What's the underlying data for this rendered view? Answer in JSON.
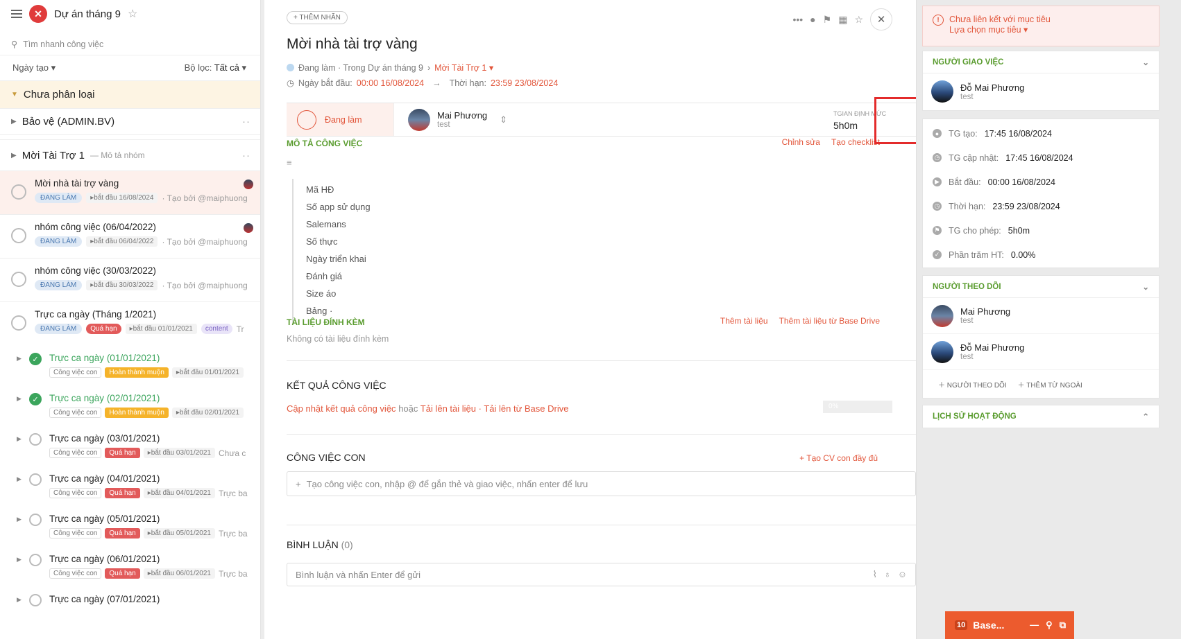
{
  "project": {
    "title": "Dự án tháng 9"
  },
  "search": {
    "placeholder": "Tìm nhanh công việc"
  },
  "filter": {
    "sort": "Ngày tạo",
    "label": "Bộ lọc:",
    "value": "Tất cả"
  },
  "groups": {
    "uncategorized": "Chưa phân loại",
    "protect": "Bảo vệ (ADMIN.BV)",
    "sponsor": "Mời Tài Trợ 1",
    "sponsor_desc": "Mô tả nhóm"
  },
  "tasks": [
    {
      "title": "Mời nhà tài trợ vàng",
      "status": "ĐANG LÀM",
      "date": "bắt đầu 16/08/2024",
      "by": "· Tạo bởi @maiphuong"
    },
    {
      "title": "nhóm công việc (06/04/2022)",
      "status": "ĐANG LÀM",
      "date": "bắt đầu 06/04/2022",
      "by": "· Tạo bởi @maiphuong"
    },
    {
      "title": "nhóm công việc (30/03/2022)",
      "status": "ĐANG LÀM",
      "date": "bắt đầu 30/03/2022",
      "by": "· Tạo bởi @maiphuong"
    },
    {
      "title": "Trực ca ngày (Tháng 1/2021)",
      "status": "ĐANG LÀM",
      "late": "Quá hạn",
      "date": "bắt đầu 01/01/2021",
      "tag": "content",
      "extra": "Tr"
    }
  ],
  "subtasks": [
    {
      "title": "Trực ca ngày (01/01/2021)",
      "cv": "Công việc con",
      "flag": "Hoàn thành muộn",
      "date": "bắt đầu 01/01/2021",
      "extra": ""
    },
    {
      "title": "Trực ca ngày (02/01/2021)",
      "cv": "Công việc con",
      "flag": "Hoàn thành muộn",
      "date": "bắt đầu 02/01/2021",
      "extra": ""
    },
    {
      "title": "Trực ca ngày (03/01/2021)",
      "cv": "Công việc con",
      "flag": "Quá hạn",
      "date": "bắt đầu 03/01/2021",
      "extra": "Chưa c"
    },
    {
      "title": "Trực ca ngày (04/01/2021)",
      "cv": "Công việc con",
      "flag": "Quá hạn",
      "date": "bắt đầu 04/01/2021",
      "extra": "Trực ba"
    },
    {
      "title": "Trực ca ngày (05/01/2021)",
      "cv": "Công việc con",
      "flag": "Quá hạn",
      "date": "bắt đầu 05/01/2021",
      "extra": "Trực ba"
    },
    {
      "title": "Trực ca ngày (06/01/2021)",
      "cv": "Công việc con",
      "flag": "Quá hạn",
      "date": "bắt đầu 06/01/2021",
      "extra": "Trực ba"
    },
    {
      "title": "Trực ca ngày (07/01/2021)",
      "cv": "",
      "flag": "",
      "date": "",
      "extra": ""
    }
  ],
  "main": {
    "add_tag": "+ THÊM NHÃN",
    "title": "Mời nhà tài trợ vàng",
    "status_text": "Đang làm · Trong Dự án tháng 9",
    "group_link": "Mời Tài Trợ 1",
    "start_label": "Ngày bắt đầu:",
    "start_value": "00:00 16/08/2024",
    "due_label": "Thời hạn:",
    "due_value": "23:59 23/08/2024",
    "state": "Đang làm",
    "assignee": "Mai Phương",
    "assignee_sub": "test",
    "tgian_label": "TGIAN ĐỊNH MỨC",
    "tgian_value": "5h0m",
    "desc_title": "MÔ TẢ CÔNG VIỆC",
    "edit": "Chỉnh sửa",
    "checklist": "Tạo checklist",
    "desc_items": [
      "Mã HĐ",
      "Số app sử dụng",
      "Salemans",
      "Số thực",
      "Ngày triển khai",
      "Đánh giá",
      "Size áo",
      "Bảng ·"
    ],
    "attach_title": "TÀI LIỆU ĐÍNH KÈM",
    "add_doc": "Thêm tài liệu",
    "add_doc_drive": "Thêm tài liệu từ Base Drive",
    "no_attach": "Không có tài liệu đính kèm",
    "result_title": "KẾT QUẢ CÔNG VIỆC",
    "progress": "0%",
    "result_update": "Cập nhật kết quả công việc",
    "result_or": "hoặc",
    "result_upload": "Tải lên tài liệu",
    "result_drive": "· Tải lên từ Base Drive",
    "subtask_title": "CÔNG VIỆC CON",
    "subtask_full": "Tạo CV con đầy đủ",
    "subtask_placeholder": "Tạo công việc con, nhập @ để gắn thẻ và giao việc, nhấn enter để lưu",
    "comment_title": "BÌNH LUẬN",
    "comment_count": "(0)",
    "comment_placeholder": "Bình luận và nhấn Enter để gửi"
  },
  "right": {
    "warn_title": "Chưa liên kết với mục tiêu",
    "warn_link": "Lựa chọn mục tiêu",
    "assigner_title": "NGƯỜI GIAO VIỆC",
    "assigner": "Đỗ Mai Phương",
    "assigner_sub": "test",
    "info": [
      {
        "label": "TG tạo:",
        "value": "17:45 16/08/2024"
      },
      {
        "label": "TG cập nhật:",
        "value": "17:45 16/08/2024"
      },
      {
        "label": "Bắt đầu:",
        "value": "00:00 16/08/2024"
      },
      {
        "label": "Thời hạn:",
        "value": "23:59 23/08/2024"
      },
      {
        "label": "TG cho phép:",
        "value": "5h0m"
      },
      {
        "label": "Phần trăm HT:",
        "value": "0.00%"
      }
    ],
    "followers_title": "NGƯỜI THEO DÕI",
    "followers": [
      {
        "name": "Mai Phương",
        "sub": "test"
      },
      {
        "name": "Đỗ Mai Phương",
        "sub": "test"
      }
    ],
    "add_follower": "NGƯỜI THEO DÕI",
    "add_external": "THÊM TỪ NGOÀI",
    "history_title": "LỊCH SỬ HOẠT ĐỘNG"
  },
  "chat": {
    "count": "10",
    "label": "Base..."
  }
}
